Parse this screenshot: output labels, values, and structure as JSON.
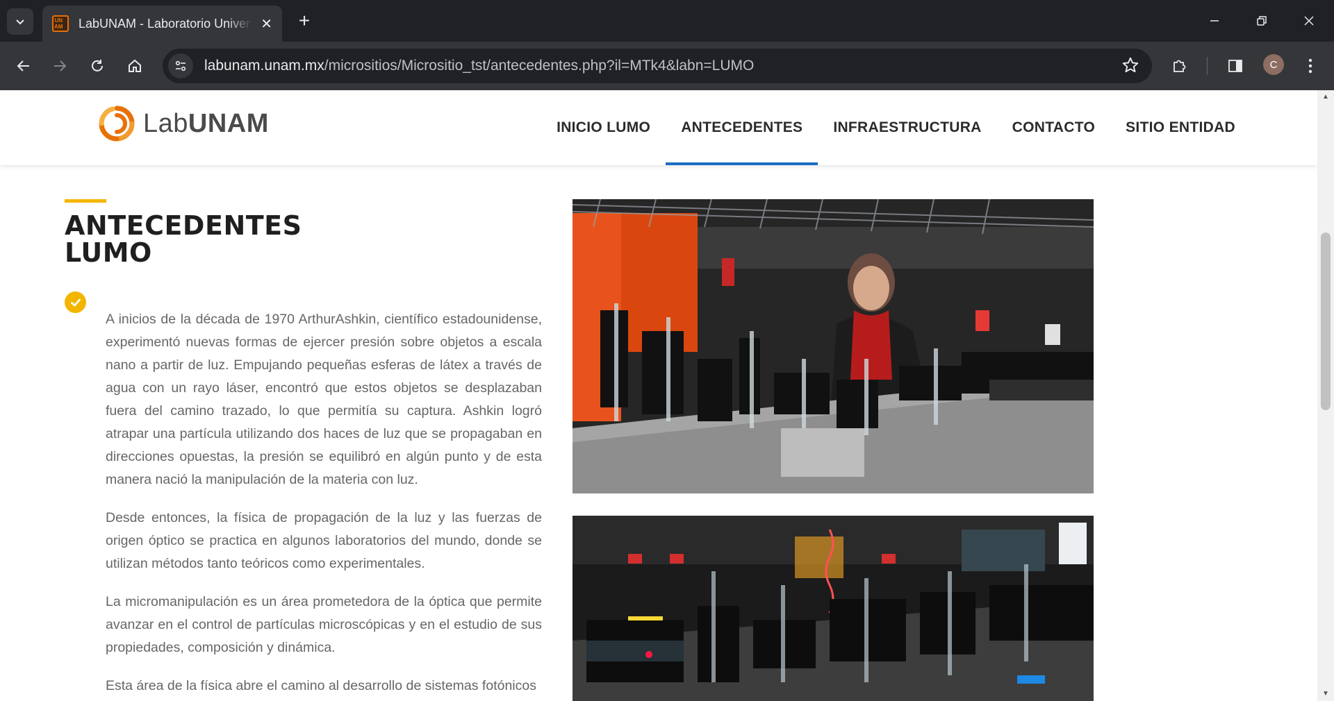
{
  "browser": {
    "tab_title": "LabUNAM - Laboratorio Universitario",
    "favicon_text": [
      "UN",
      "AM"
    ],
    "url_host": "labunam.unam.mx",
    "url_path": "/micrositios/Micrositio_tst/antecedentes.php?il=MTk4&labn=LUMO",
    "profile_initial": "C"
  },
  "site": {
    "logo_lab": "Lab",
    "logo_unam": "UNAM",
    "nav": [
      {
        "label": "INICIO LUMO",
        "active": false
      },
      {
        "label": "ANTECEDENTES",
        "active": true
      },
      {
        "label": "INFRAESTRUCTURA",
        "active": false
      },
      {
        "label": "CONTACTO",
        "active": false
      },
      {
        "label": "SITIO ENTIDAD",
        "active": false
      }
    ]
  },
  "content": {
    "title_line1": "ANTECEDENTES",
    "title_line2": "LUMO",
    "paragraphs": [
      "A inicios de la década de 1970 ArthurAshkin, científico estadounidense, experimentó nuevas formas de ejercer presión sobre objetos a escala nano a partir de  luz. Empujando pequeñas esferas de látex a través de agua con un rayo láser, encontró que estos objetos se desplazaban fuera del camino trazado, lo que permitía su captura. Ashkin logró atrapar una partícula utilizando dos haces de luz que se propagaban en direcciones opuestas, la presión se equilibró en algún punto y de esta manera nació la manipulación de la materia con luz.",
      "Desde entonces, la física de propagación de la luz y las fuerzas de origen óptico se practica en algunos laboratorios del mundo, donde se utilizan métodos tanto teóricos como experimentales.",
      "La micromanipulación es un área prometedora de la óptica que permite avanzar en el control de partículas microscópicas y en el estudio de sus propiedades, composición y dinámica.",
      "Esta área de la física abre el camino al desarrollo de sistemas fotónicos"
    ]
  },
  "colors": {
    "accent": "#f2b600",
    "nav_active": "#1b6dc1",
    "logo_orange": "#e8710a"
  }
}
